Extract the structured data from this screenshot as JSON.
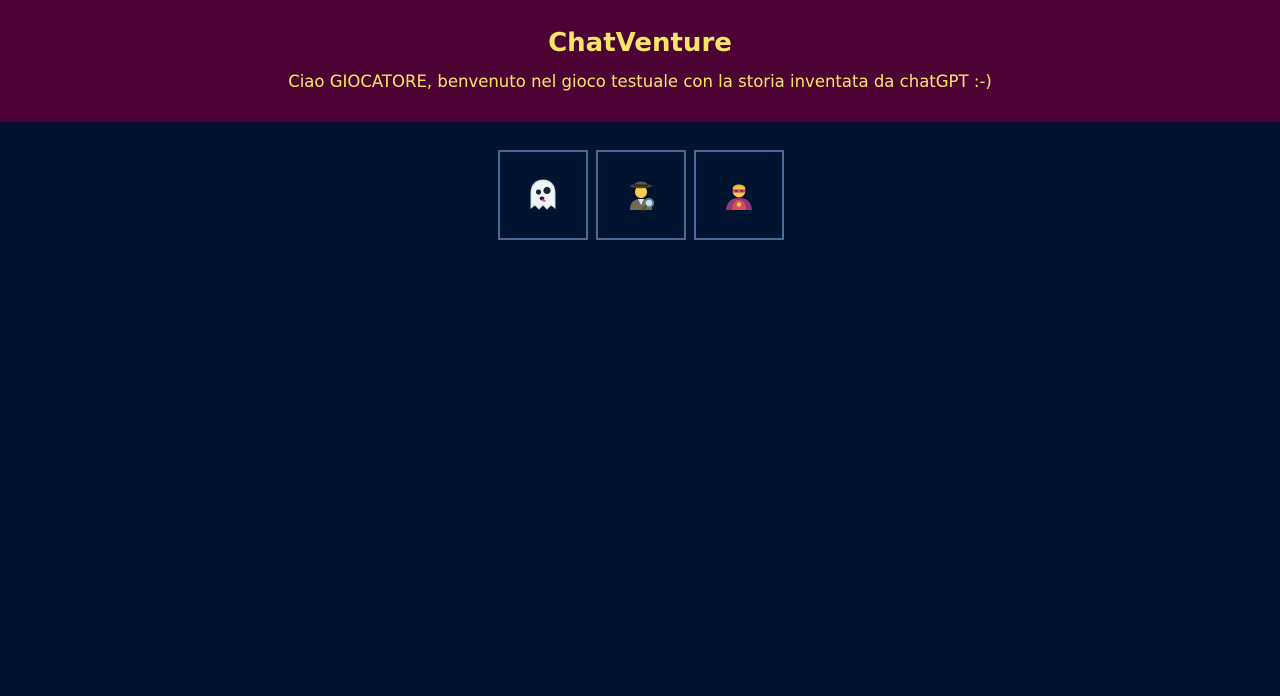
{
  "header": {
    "title": "ChatVenture",
    "subtitle": "Ciao GIOCATORE, benvenuto nel gioco testuale con la storia inventata da chatGPT :-)"
  },
  "choices": [
    {
      "icon": "ghost-icon"
    },
    {
      "icon": "detective-icon"
    },
    {
      "icon": "superhero-icon"
    }
  ],
  "colors": {
    "header_bg": "#4c0333",
    "page_bg": "#001430",
    "text_accent": "#f7e46a",
    "choice_border": "#4a6a96"
  }
}
